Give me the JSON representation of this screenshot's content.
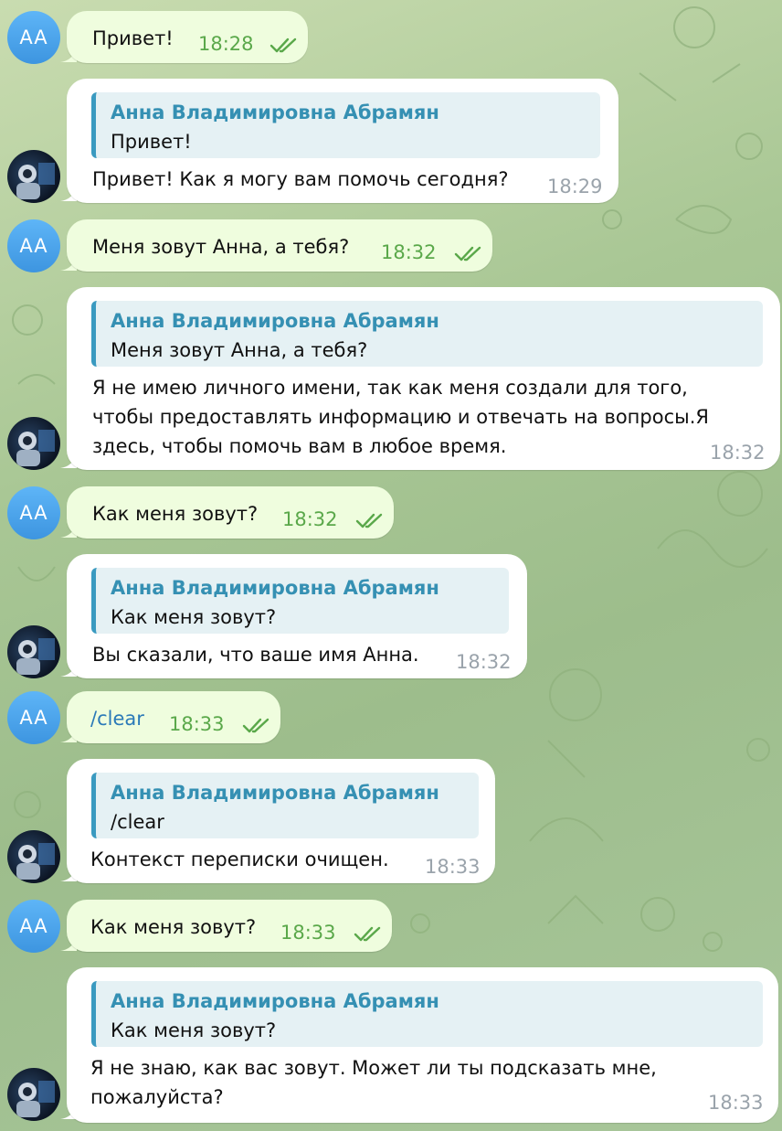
{
  "user_avatar_initials": "AA",
  "messages": [
    {
      "kind": "out",
      "text": "Привет!",
      "time": "18:28"
    },
    {
      "kind": "in",
      "quote_author": "Анна Владимировна Абрамян",
      "quote_text": "Привет!",
      "text": "Привет! Как я могу вам помочь сегодня?",
      "time": "18:29"
    },
    {
      "kind": "out",
      "text": "Меня зовут Анна, а тебя?",
      "time": "18:32"
    },
    {
      "kind": "in",
      "quote_author": "Анна Владимировна Абрамян",
      "quote_text": "Меня зовут Анна, а тебя?",
      "text": "Я не имею личного имени, так как меня создали для того,\nчтобы предоставлять информацию и отвечать на вопросы.Я\nздесь, чтобы помочь вам в любое время.",
      "time": "18:32"
    },
    {
      "kind": "out",
      "text": "Как меня зовут?",
      "time": "18:32"
    },
    {
      "kind": "in",
      "quote_author": "Анна Владимировна Абрамян",
      "quote_text": "Как меня зовут?",
      "text": "Вы сказали, что ваше имя Анна.",
      "time": "18:32"
    },
    {
      "kind": "out",
      "text": "/clear",
      "time": "18:33",
      "command": true
    },
    {
      "kind": "in",
      "quote_author": "Анна Владимировна Абрамян",
      "quote_text": "/clear",
      "text": "Контекст переписки очищен.",
      "time": "18:33"
    },
    {
      "kind": "out",
      "text": "Как меня зовут?",
      "time": "18:33"
    },
    {
      "kind": "in",
      "quote_author": "Анна Владимировна Абрамян",
      "quote_text": "Как меня зовут?",
      "text": "Я не знаю, как вас зовут. Может ли ты подсказать мне,\nпожалуйста?",
      "time": "18:33"
    }
  ],
  "colors": {
    "outgoing_bubble": "#effdde",
    "incoming_bubble": "#ffffff",
    "quote_accent": "#3a9ac0",
    "read_checks": "#5aa84a"
  }
}
